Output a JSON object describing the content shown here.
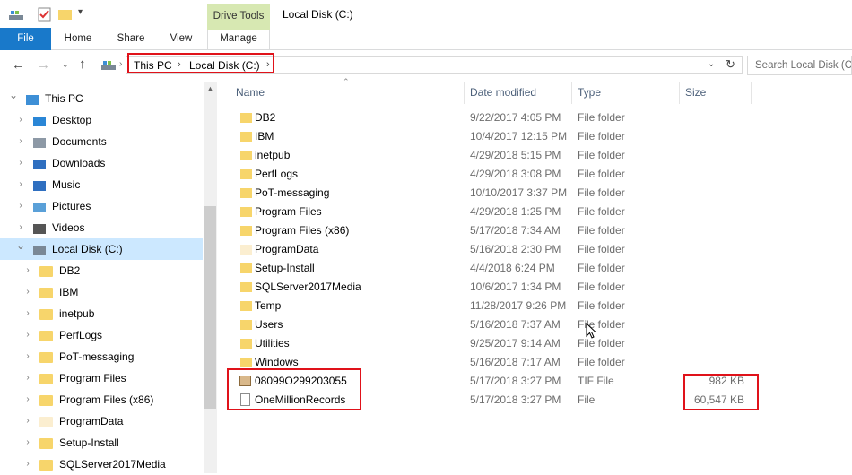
{
  "window": {
    "title": "Local Disk (C:)"
  },
  "ribbon": {
    "file": "File",
    "home": "Home",
    "share": "Share",
    "view": "View",
    "manage": "Manage",
    "drive_tools": "Drive Tools"
  },
  "address": {
    "this_pc": "This PC",
    "local_disk": "Local Disk (C:)"
  },
  "search": {
    "placeholder": "Search Local Disk (C:)"
  },
  "nav": [
    {
      "label": "This PC",
      "level": 0,
      "icon": "computer-icon",
      "expanded": true
    },
    {
      "label": "Desktop",
      "level": 1,
      "icon": "desktop-icon"
    },
    {
      "label": "Documents",
      "level": 1,
      "icon": "documents-icon"
    },
    {
      "label": "Downloads",
      "level": 1,
      "icon": "downloads-icon"
    },
    {
      "label": "Music",
      "level": 1,
      "icon": "music-icon"
    },
    {
      "label": "Pictures",
      "level": 1,
      "icon": "pictures-icon"
    },
    {
      "label": "Videos",
      "level": 1,
      "icon": "videos-icon"
    },
    {
      "label": "Local Disk (C:)",
      "level": 1,
      "icon": "drive-icon",
      "expanded": true,
      "selected": true
    },
    {
      "label": "DB2",
      "level": 2,
      "icon": "folder-icon"
    },
    {
      "label": "IBM",
      "level": 2,
      "icon": "folder-icon"
    },
    {
      "label": "inetpub",
      "level": 2,
      "icon": "folder-icon"
    },
    {
      "label": "PerfLogs",
      "level": 2,
      "icon": "folder-icon"
    },
    {
      "label": "PoT-messaging",
      "level": 2,
      "icon": "folder-icon"
    },
    {
      "label": "Program Files",
      "level": 2,
      "icon": "folder-icon"
    },
    {
      "label": "Program Files (x86)",
      "level": 2,
      "icon": "folder-icon"
    },
    {
      "label": "ProgramData",
      "level": 2,
      "icon": "folder-light-icon"
    },
    {
      "label": "Setup-Install",
      "level": 2,
      "icon": "folder-icon"
    },
    {
      "label": "SQLServer2017Media",
      "level": 2,
      "icon": "folder-icon"
    }
  ],
  "columns": {
    "name": "Name",
    "date": "Date modified",
    "type": "Type",
    "size": "Size"
  },
  "files": [
    {
      "name": "DB2",
      "date": "9/22/2017 4:05 PM",
      "type": "File folder",
      "size": "",
      "icon": "folder-icon"
    },
    {
      "name": "IBM",
      "date": "10/4/2017 12:15 PM",
      "type": "File folder",
      "size": "",
      "icon": "folder-icon"
    },
    {
      "name": "inetpub",
      "date": "4/29/2018 5:15 PM",
      "type": "File folder",
      "size": "",
      "icon": "folder-icon"
    },
    {
      "name": "PerfLogs",
      "date": "4/29/2018 3:08 PM",
      "type": "File folder",
      "size": "",
      "icon": "folder-icon"
    },
    {
      "name": "PoT-messaging",
      "date": "10/10/2017 3:37 PM",
      "type": "File folder",
      "size": "",
      "icon": "folder-icon"
    },
    {
      "name": "Program Files",
      "date": "4/29/2018 1:25 PM",
      "type": "File folder",
      "size": "",
      "icon": "folder-icon"
    },
    {
      "name": "Program Files (x86)",
      "date": "5/17/2018 7:34 AM",
      "type": "File folder",
      "size": "",
      "icon": "folder-icon"
    },
    {
      "name": "ProgramData",
      "date": "5/16/2018 2:30 PM",
      "type": "File folder",
      "size": "",
      "icon": "folder-light-icon"
    },
    {
      "name": "Setup-Install",
      "date": "4/4/2018 6:24 PM",
      "type": "File folder",
      "size": "",
      "icon": "folder-icon"
    },
    {
      "name": "SQLServer2017Media",
      "date": "10/6/2017 1:34 PM",
      "type": "File folder",
      "size": "",
      "icon": "folder-icon"
    },
    {
      "name": "Temp",
      "date": "11/28/2017 9:26 PM",
      "type": "File folder",
      "size": "",
      "icon": "folder-icon"
    },
    {
      "name": "Users",
      "date": "5/16/2018 7:37 AM",
      "type": "File folder",
      "size": "",
      "icon": "folder-icon"
    },
    {
      "name": "Utilities",
      "date": "9/25/2017 9:14 AM",
      "type": "File folder",
      "size": "",
      "icon": "folder-icon"
    },
    {
      "name": "Windows",
      "date": "5/16/2018 7:17 AM",
      "type": "File folder",
      "size": "",
      "icon": "folder-icon"
    },
    {
      "name": "08099O299203055",
      "date": "5/17/2018 3:27 PM",
      "type": "TIF File",
      "size": "982 KB",
      "icon": "image-file-icon"
    },
    {
      "name": "OneMillionRecords",
      "date": "5/17/2018 3:27 PM",
      "type": "File",
      "size": "60,547 KB",
      "icon": "file-icon"
    }
  ]
}
